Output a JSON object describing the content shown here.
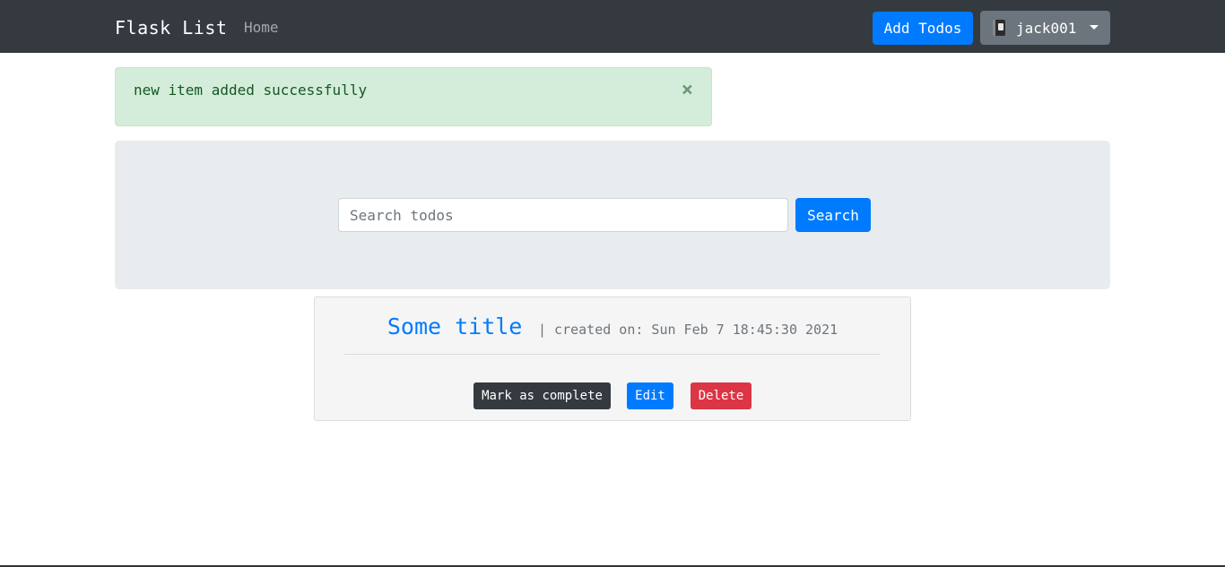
{
  "navbar": {
    "brand": "Flask List",
    "home_link": "Home",
    "add_todos_button": "Add Todos",
    "user": {
      "username": "jack001",
      "icon": "notebook-icon"
    }
  },
  "alert": {
    "message": "new item added successfully",
    "close_glyph": "×",
    "type": "success"
  },
  "search": {
    "placeholder": "Search todos",
    "value": "",
    "button_label": "Search"
  },
  "todos": [
    {
      "title": "Some title",
      "meta": "| created on: Sun Feb 7 18:45:30 2021",
      "actions": {
        "complete": "Mark as complete",
        "edit": "Edit",
        "delete": "Delete"
      }
    }
  ],
  "colors": {
    "navbar": "#343a40",
    "primary": "#007bff",
    "secondary": "#6c757d",
    "danger": "#dc3545",
    "success_bg": "#d4edda",
    "jumbotron": "#e9ecef"
  }
}
